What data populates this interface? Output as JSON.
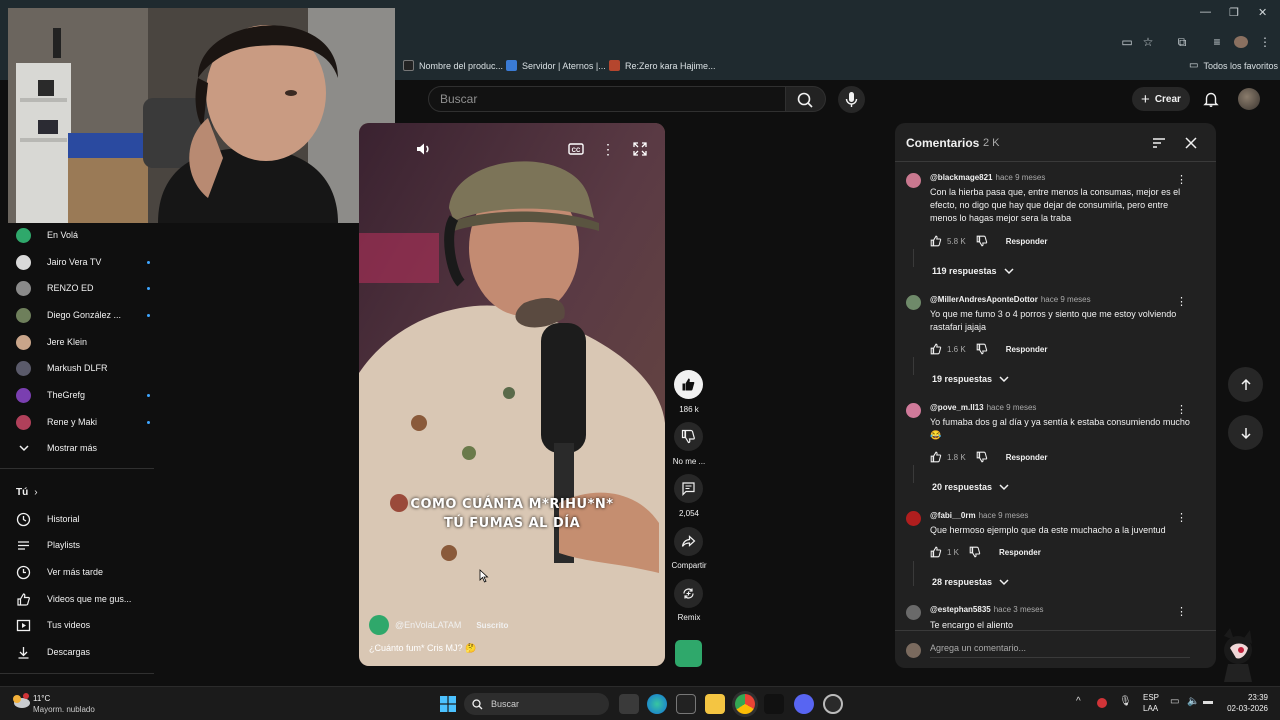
{
  "browser": {
    "bookmarks": [
      {
        "label": "Nombre del produc...",
        "color": "#222222"
      },
      {
        "label": "Servidor | Aternos |...",
        "color": "#3a7bd5"
      },
      {
        "label": "Re:Zero kara Hajime...",
        "color": "#b5462e"
      }
    ],
    "all_bookmarks_label": "Todos los favoritos"
  },
  "header": {
    "search_placeholder": "Buscar",
    "create_label": "Crear"
  },
  "sidebar": {
    "subscriptions": [
      {
        "name": "En Volá",
        "color": "#2fa86b",
        "dot": false
      },
      {
        "name": "Jairo Vera TV",
        "color": "#d9d9d9",
        "dot": true
      },
      {
        "name": "RENZO ED",
        "color": "#8a8a8a",
        "dot": true
      },
      {
        "name": "Diego González ...",
        "color": "#6e7f5b",
        "dot": true
      },
      {
        "name": "Jere Klein",
        "color": "#c9a58a",
        "dot": false
      },
      {
        "name": "Markush DLFR",
        "color": "#5a5a6a",
        "dot": false
      },
      {
        "name": "TheGrefg",
        "color": "#7a3fb0",
        "dot": true
      },
      {
        "name": "Rene y Maki",
        "color": "#b0405a",
        "dot": true
      }
    ],
    "show_more": "Mostrar más",
    "you_section": "Tú",
    "you_items": [
      {
        "label": "Historial",
        "icon": "history-icon"
      },
      {
        "label": "Playlists",
        "icon": "playlists-icon"
      },
      {
        "label": "Ver más tarde",
        "icon": "watch-later-icon"
      },
      {
        "label": "Videos que me gus...",
        "icon": "liked-videos-icon"
      },
      {
        "label": "Tus videos",
        "icon": "your-videos-icon"
      },
      {
        "label": "Descargas",
        "icon": "downloads-icon"
      }
    ]
  },
  "video": {
    "caption_line1": "COMO CUÁNTA M*RIHU*N*",
    "caption_line2": "TÚ FUMAS AL DÍA",
    "channel": "@EnVolaLATAM",
    "subscribed": "Suscrito",
    "title": "¿Cuánto fum* Cris MJ? 🤔"
  },
  "actions": {
    "likes": "186 k",
    "dislike_label": "No me ...",
    "comments": "2,054",
    "share_label": "Compartir",
    "remix_label": "Remix"
  },
  "comments_panel": {
    "title": "Comentarios",
    "count": "2 K",
    "reply_label": "Responder",
    "add_placeholder": "Agrega un comentario...",
    "comments": [
      {
        "user": "@blackmage821",
        "time": "hace 9 meses",
        "text": "Con la hierba pasa que, entre menos la consumas, mejor es el efecto, no digo que hay que dejar de consumirla, pero entre menos lo hagas mejor sera la traba",
        "likes": "5.8 K",
        "replies": "119 respuestas",
        "color": "#c9788f"
      },
      {
        "user": "@MillerAndresAponteDottor",
        "time": "hace 9 meses",
        "text": "Yo que me fumo 3 o 4 porros y siento que me estoy volviendo rastafari jajaja",
        "likes": "1.6 K",
        "replies": "19 respuestas",
        "color": "#6f8a6a"
      },
      {
        "user": "@pove_m.ll13",
        "time": "hace 9 meses",
        "text": "Yo fumaba dos g al día y ya sentía k estaba consumiendo mucho 😂",
        "likes": "1.8 K",
        "replies": "20 respuestas",
        "color": "#d07a9a"
      },
      {
        "user": "@fabi__0rm",
        "time": "hace 9 meses",
        "text": "Que hermoso ejemplo que da este muchacho a la juventud",
        "likes": "1 K",
        "replies": "28 respuestas",
        "color": "#b01e1e"
      },
      {
        "user": "@estephan5835",
        "time": "hace 3 meses",
        "text": "Te encargo el aliento",
        "likes": "",
        "replies": "",
        "color": "#6a6a6a"
      }
    ]
  },
  "taskbar": {
    "weather_temp": "11°C",
    "weather_desc": "Mayorm. nublado",
    "search_label": "Buscar",
    "lang1": "ESP",
    "lang2": "LAA",
    "time": "23:39",
    "date": "02-03-2026"
  }
}
